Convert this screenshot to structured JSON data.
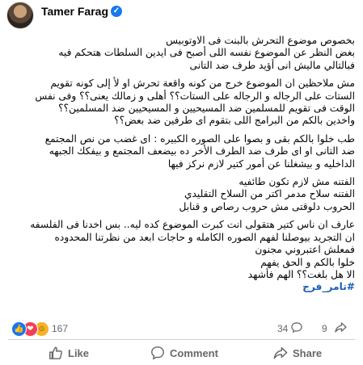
{
  "author": {
    "name": "Tamer Farag"
  },
  "post": {
    "paragraphs": [
      {
        "lines": [
          "بخصوص موضوع التحرش بالبنت فى الاوتوبيس",
          "بغض النظر عن الموضوع نفسه اللى أصبح فى ايدين السلطات هتحكم فيه",
          "فبالتالي ماليش انى أؤيد طرف ضد التانى"
        ]
      },
      {
        "lines": [
          "مش ملاحظين ان الموضوع خرج من كونه واقعة تحرش او لأ إلى كونه تقويم",
          "الستات على الرجاله و الرجاله على الستات؟؟ أهلى و زمالك يعنى؟؟ وفى نفس",
          "الوقت فى تقويم للمسلمين ضد المسيحيين و المسيحيين ضد المسلمين؟؟",
          "واخدين بالكم من البرامج اللى بتقوم اى طرفين ضد بعض؟؟"
        ]
      },
      {
        "lines": [
          "طب خلوا بالكم بقى و بصوا على الصوره الكبيره : اى غضب من نص المجتمع",
          "ضد التانى او اى طرف ضد الطرف الأخر ده بيضعف المجتمع و بيفكك الجبهه",
          "الداخليه و بيشغلنا عن أمور كتير لازم نركز فيها"
        ]
      },
      {
        "lines": [
          "الفتنه مش لازم تكون طائفيه",
          "الفتنه سلاح مدمر اكتر من السلاح التقليدي",
          "الحروب دلوقتى مش حروب رصاص و قنابل"
        ]
      },
      {
        "lines": [
          "عارف ان ناس كتير هتقولى انت كبرت الموضوع كده ليه.. بس اخدنا فى الفلسفه",
          "ان التجريد بيوصلنا لفهم الصوره الكامله و حاجات ابعد من نظرتنا المحدوده",
          "فمعلش اعتبروني مجنون",
          "خلوا بالكم و الحق يفهم",
          "الا هل بلغت؟؟ الهم فأشهد"
        ]
      }
    ],
    "hashtag": "#تامر_فرج"
  },
  "stats": {
    "reactions": "167",
    "comments": "34",
    "shares": "9"
  },
  "actions": {
    "like": "Like",
    "comment": "Comment",
    "share": "Share"
  },
  "colors": {
    "accent": "#1877f2",
    "hashtag": "#1a5fb4",
    "muted": "#65676b"
  }
}
